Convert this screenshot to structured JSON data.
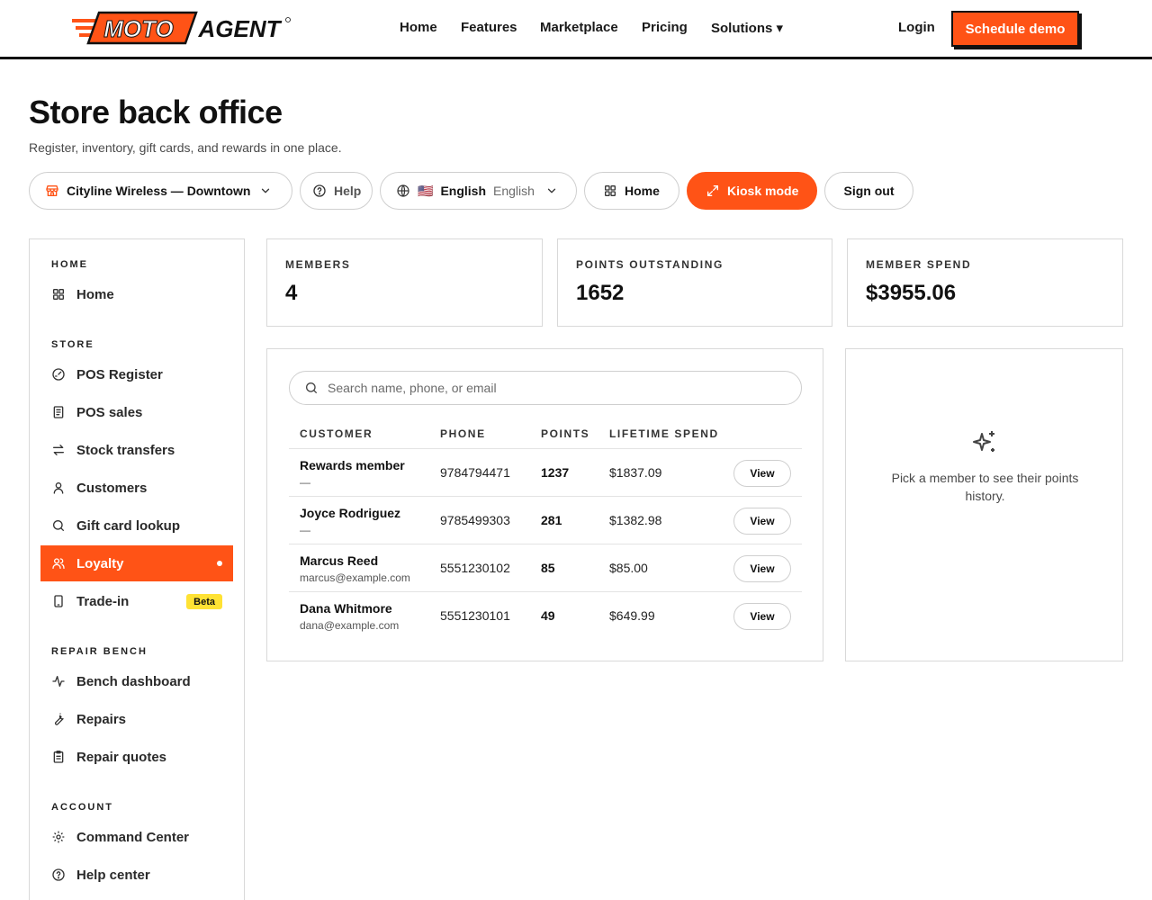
{
  "brand": {
    "part1": "MOTO",
    "part2": "AGENT",
    "accent": "#ff5316"
  },
  "nav": {
    "links": [
      "Home",
      "Features",
      "Marketplace",
      "Pricing",
      "Solutions ▾"
    ],
    "login": "Login",
    "schedule_demo": "Schedule demo"
  },
  "header": {
    "title": "Store back office",
    "subtitle": "Register, inventory, gift cards, and rewards in one place."
  },
  "toolbar": {
    "store": "Cityline Wireless — Downtown",
    "help": "Help",
    "lang_flag": "🇺🇸",
    "lang_native": "English",
    "lang_english": "English",
    "home": "Home",
    "kiosk": "Kiosk mode",
    "sign_out": "Sign out"
  },
  "sidebar": {
    "sections": [
      {
        "label": "HOME",
        "items": [
          {
            "label": "Home",
            "icon": "grid-icon"
          }
        ]
      },
      {
        "label": "STORE",
        "items": [
          {
            "label": "POS Register",
            "icon": "gauge-icon"
          },
          {
            "label": "POS sales",
            "icon": "receipt-icon"
          },
          {
            "label": "Stock transfers",
            "icon": "arrows-icon"
          },
          {
            "label": "Customers",
            "icon": "user-icon"
          },
          {
            "label": "Gift card lookup",
            "icon": "search-icon"
          },
          {
            "label": "Loyalty",
            "icon": "users-icon",
            "active": true
          },
          {
            "label": "Trade-in",
            "icon": "phone-icon",
            "badge": "Beta"
          }
        ]
      },
      {
        "label": "REPAIR BENCH",
        "items": [
          {
            "label": "Bench dashboard",
            "icon": "activity-icon"
          },
          {
            "label": "Repairs",
            "icon": "wrench-icon"
          },
          {
            "label": "Repair quotes",
            "icon": "clipboard-icon"
          }
        ]
      },
      {
        "label": "ACCOUNT",
        "items": [
          {
            "label": "Command Center",
            "icon": "gear-icon"
          },
          {
            "label": "Help center",
            "icon": "help-icon"
          }
        ]
      }
    ]
  },
  "stats": [
    {
      "label": "MEMBERS",
      "value": "4"
    },
    {
      "label": "POINTS OUTSTANDING",
      "value": "1652"
    },
    {
      "label": "MEMBER SPEND",
      "value": "$3955.06"
    }
  ],
  "table": {
    "search_placeholder": "Search name, phone, or email",
    "columns": [
      "CUSTOMER",
      "PHONE",
      "POINTS",
      "LIFETIME SPEND"
    ],
    "rows": [
      {
        "name": "Rewards member",
        "sub": "—",
        "phone": "9784794471",
        "points": "1237",
        "spend": "$1837.09",
        "action": "View"
      },
      {
        "name": "Joyce Rodriguez",
        "sub": "—",
        "phone": "9785499303",
        "points": "281",
        "spend": "$1382.98",
        "action": "View"
      },
      {
        "name": "Marcus Reed",
        "sub": "marcus@example.com",
        "phone": "5551230102",
        "points": "85",
        "spend": "$85.00",
        "action": "View"
      },
      {
        "name": "Dana Whitmore",
        "sub": "dana@example.com",
        "phone": "5551230101",
        "points": "49",
        "spend": "$649.99",
        "action": "View"
      }
    ]
  },
  "detail": {
    "empty_message": "Pick a member to see their points history."
  }
}
